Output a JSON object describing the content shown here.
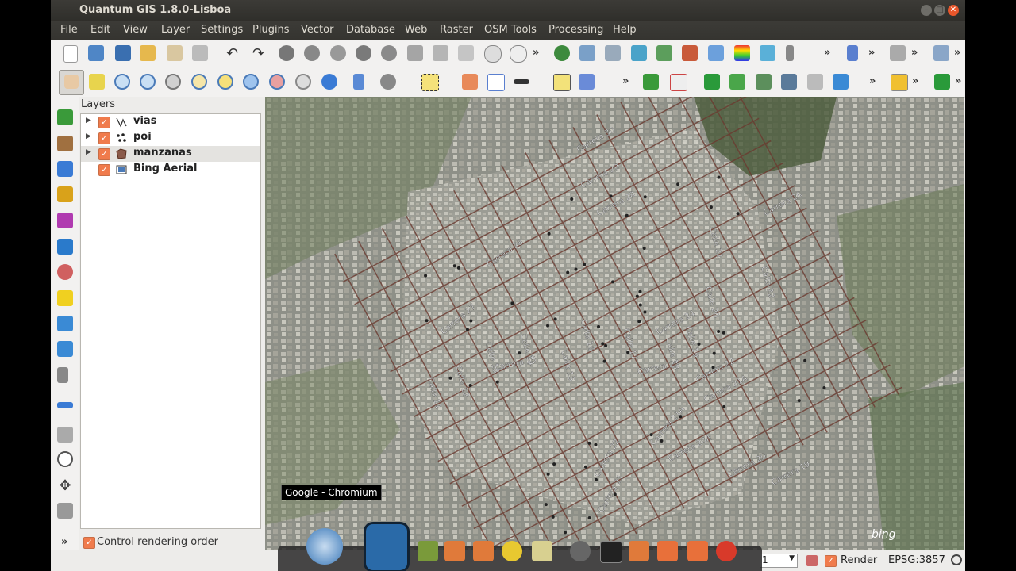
{
  "window": {
    "title": "Quantum GIS 1.8.0-Lisboa"
  },
  "menu": [
    "File",
    "Edit",
    "View",
    "Layer",
    "Settings",
    "Plugins",
    "Vector",
    "Database",
    "Web",
    "Raster",
    "OSM Tools",
    "Processing",
    "Help"
  ],
  "toolbars": {
    "overflow_chevron": "»"
  },
  "layers_panel": {
    "title": "Layers",
    "float_icon": "⧉",
    "close_icon": "✕",
    "layers": [
      {
        "name": "vias",
        "checked": true,
        "expandable": true,
        "icon": "line-layer-icon"
      },
      {
        "name": "poi",
        "checked": true,
        "expandable": true,
        "icon": "point-layer-icon"
      },
      {
        "name": "manzanas",
        "checked": true,
        "expandable": true,
        "icon": "polygon-layer-icon",
        "selected": true
      },
      {
        "name": "Bing Aerial",
        "checked": true,
        "expandable": false,
        "icon": "raster-layer-icon"
      }
    ],
    "control_rendering_order": {
      "label": "Control rendering order",
      "checked": true
    }
  },
  "map": {
    "street_labels": [
      "Carrera 30",
      "Carrera 29",
      "Carrera 28",
      "Carrera 28",
      "Carrera 27",
      "Carrera 26",
      "Carrera 25",
      "Carrera 24",
      "Carrera 23",
      "Carrera 22",
      "Carrera 21A",
      "Carrera 21A",
      "Carrera 20A",
      "Carrera 20",
      "Carrera 19",
      "Carrera 22",
      "Carrera 21",
      "Calle 21",
      "Calle 22",
      "Calle 20",
      "Calle 19",
      "Calle 18",
      "Calle 17",
      "Calle 16",
      "Calle 15",
      "Calle 14",
      "Calle 13",
      "Calle 12",
      "Calle 11"
    ],
    "attribution_logo": "bing"
  },
  "status": {
    "scale_value": "1",
    "render_label": "Render",
    "render_checked": true,
    "crs": "EPSG:3857"
  },
  "taskbar": {
    "tooltip": "Google - Chromium"
  }
}
